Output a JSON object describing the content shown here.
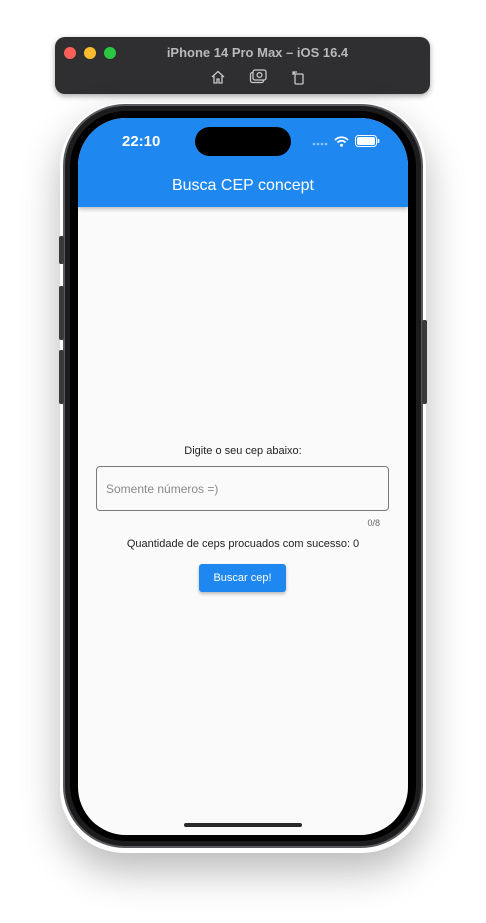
{
  "simulator": {
    "title": "iPhone 14 Pro Max – iOS 16.4",
    "tools": [
      "home-icon",
      "screenshot-icon",
      "rotate-icon"
    ]
  },
  "status_bar": {
    "time": "22:10",
    "icons": [
      "signal-icon",
      "wifi-icon",
      "battery-icon"
    ]
  },
  "app_bar": {
    "title": "Busca CEP concept",
    "color": "#1e88f0"
  },
  "form": {
    "prompt": "Digite o seu cep abaixo:",
    "cep_input": {
      "value": "",
      "placeholder": "Somente números =)"
    },
    "counter": "0/8",
    "success_text": "Quantidade de ceps procuados com sucesso: 0",
    "search_button": "Buscar cep!"
  }
}
